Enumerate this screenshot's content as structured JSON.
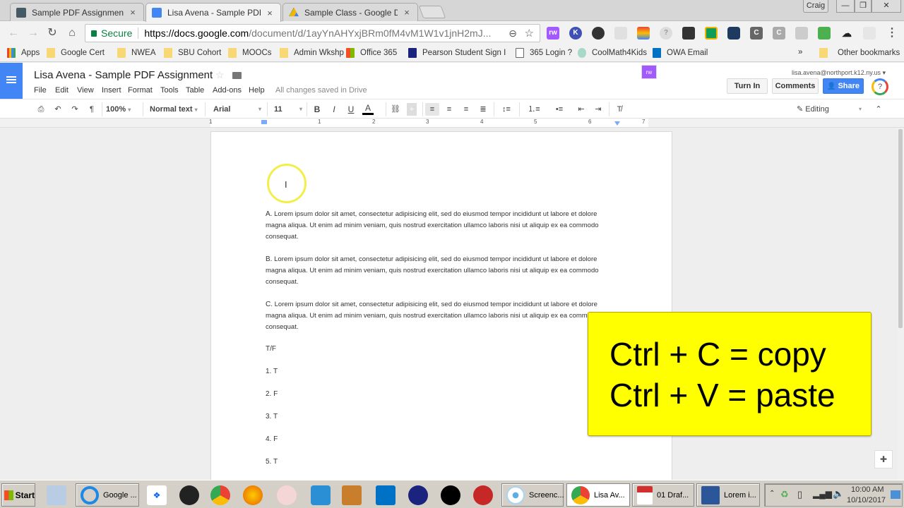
{
  "browser": {
    "tabs": [
      {
        "label": "Sample PDF Assignment",
        "icon": "classroom-icon",
        "active": false
      },
      {
        "label": "Lisa Avena - Sample PDF As",
        "icon": "docs-icon",
        "active": true
      },
      {
        "label": "Sample Class - Google Drive",
        "icon": "drive-icon",
        "active": false
      }
    ],
    "close_glyph": "×",
    "profile_name": "Craig",
    "window_controls": {
      "minimize": "—",
      "restore": "❐",
      "close": "✕"
    },
    "nav": {
      "back": "←",
      "forward": "→",
      "reload": "↻",
      "home": "⌂"
    },
    "secure_label": "Secure",
    "url_host": "https://docs.google.com",
    "url_path": "/document/d/1ayYnAHYxjBRm0fM4vM1W1v1jnH2mJ...",
    "menu_glyph": "⋮",
    "bookmarks": [
      {
        "label": "Apps",
        "icon": "apps-icon"
      },
      {
        "label": "Google Cert",
        "icon": "folder-icon"
      },
      {
        "label": "NWEA",
        "icon": "folder-icon"
      },
      {
        "label": "SBU Cohort",
        "icon": "folder-icon"
      },
      {
        "label": "MOOCs",
        "icon": "folder-icon"
      },
      {
        "label": "Admin Wkshp",
        "icon": "folder-icon"
      },
      {
        "label": "Office 365",
        "icon": "office-icon"
      },
      {
        "label": "Pearson Student Sign I",
        "icon": "pearson-icon"
      },
      {
        "label": "365 Login ?",
        "icon": "page-icon"
      },
      {
        "label": "CoolMath4Kids",
        "icon": "coolmath-icon"
      },
      {
        "label": "OWA Email",
        "icon": "outlook-icon"
      }
    ],
    "bookmarks_overflow": "»",
    "other_bookmarks": "Other bookmarks"
  },
  "docs": {
    "title": "Lisa Avena - Sample PDF Assignment",
    "menu": [
      "File",
      "Edit",
      "View",
      "Insert",
      "Format",
      "Tools",
      "Table",
      "Add-ons",
      "Help"
    ],
    "save_status": "All changes saved in Drive",
    "account": "lisa.avena@northport.k12.ny.us ▾",
    "turn_in": "Turn In",
    "comments": "Comments",
    "share": "Share",
    "toolbar": {
      "zoom": "100%",
      "style": "Normal text",
      "font": "Arial",
      "size": "11",
      "bold": "B",
      "italic": "I",
      "underline": "U",
      "text_color": "A",
      "mode": "Editing"
    },
    "ruler_numbers": [
      "1",
      "1",
      "2",
      "3",
      "4",
      "5",
      "6",
      "7"
    ],
    "content": {
      "paragraphs": [
        {
          "letter": "A.",
          "text": " Lorem ipsum dolor sit amet, consectetur adipisicing elit, sed do eiusmod tempor incididunt ut labore et dolore magna aliqua. Ut enim ad minim veniam, quis nostrud exercitation ullamco laboris nisi ut aliquip ex ea commodo consequat."
        },
        {
          "letter": "B.",
          "text": " Lorem ipsum dolor sit amet, consectetur adipisicing elit, sed do eiusmod tempor incididunt ut labore et dolore magna aliqua. Ut enim ad minim veniam, quis nostrud exercitation ullamco laboris nisi ut aliquip ex ea commodo consequat."
        },
        {
          "letter": "C.",
          "text": " Lorem ipsum dolor sit amet, consectetur adipisicing elit, sed do eiusmod tempor incididunt ut labore et dolore magna aliqua. Ut enim ad minim veniam, quis nostrud exercitation ullamco laboris nisi ut aliquip ex ea commodo consequat."
        }
      ],
      "tf_heading": "T/F",
      "tf_answers": [
        "1. T",
        "2. F",
        "3. T",
        "4. F",
        "5. T"
      ]
    }
  },
  "overlay": {
    "line1": "Ctrl + C = copy",
    "line2": "Ctrl + V = paste",
    "color": "#ffff00"
  },
  "taskbar": {
    "start": "Start",
    "tasks": [
      {
        "label": "Google ...",
        "icon": "ie-icon"
      },
      {
        "label": "Screenc...",
        "icon": "screencast-icon"
      },
      {
        "label": "Lisa Av...",
        "icon": "chrome-icon",
        "active": true
      },
      {
        "label": "01 Draf...",
        "icon": "pdf-icon"
      },
      {
        "label": "Lorem i...",
        "icon": "word-icon"
      }
    ],
    "time": "10:00 AM",
    "date": "10/10/2017"
  }
}
